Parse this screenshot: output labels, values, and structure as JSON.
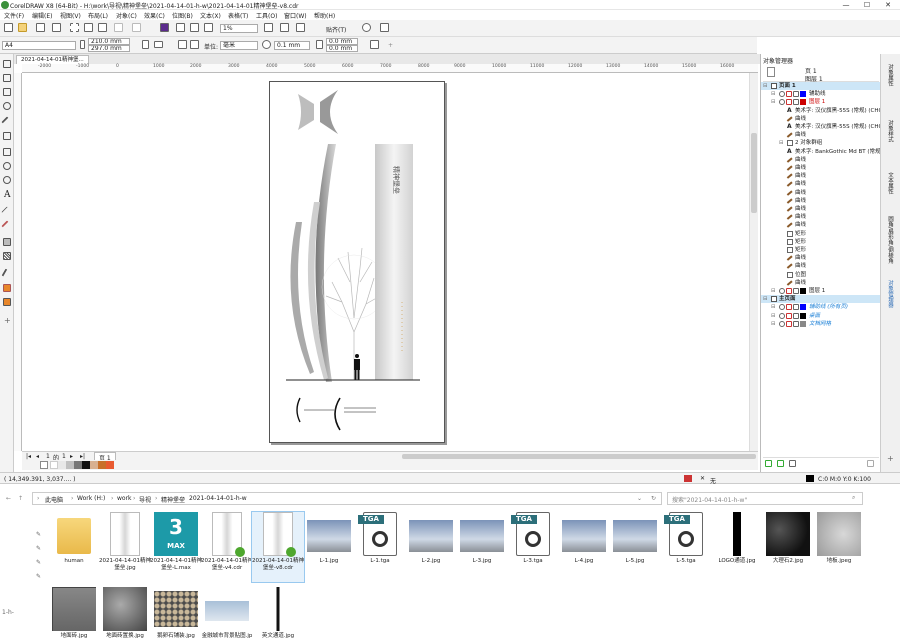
{
  "window": {
    "title": "CorelDRAW X8 (64-Bit) - H:\\work\\导视\\精神堡垒\\2021-04-14-01-h-w\\2021-04-14-01精神堡垒-v8.cdr",
    "minimize": "—",
    "maximize": "☐",
    "close": "✕"
  },
  "menu": [
    "文件(F)",
    "编辑(E)",
    "视图(V)",
    "布局(L)",
    "对象(C)",
    "效果(C)",
    "位图(B)",
    "文本(X)",
    "表格(T)",
    "工具(O)",
    "窗口(W)",
    "帮助(H)"
  ],
  "toolbar": {
    "zoom": "1%",
    "snap_label": "贴齐(T)"
  },
  "propbar": {
    "page_size": "A4",
    "width": "210.0 mm",
    "height": "297.0 mm",
    "units_label": "单位:",
    "units": "毫米",
    "nudge": "0.1 mm",
    "dup_offset": "20.0 mm",
    "dup_x": "0.0 mm",
    "dup_y": "0.0 mm"
  },
  "document_tab": "2021-04-14-01精神堡...",
  "ruler_ticks": [
    "-2000",
    "-1000",
    "0",
    "1000",
    "2000",
    "3000",
    "4000",
    "5000",
    "6000",
    "7000",
    "8000",
    "9000",
    "10000",
    "11000",
    "12000",
    "13000",
    "14000",
    "15000",
    "16000",
    "17000"
  ],
  "artwork": {
    "column_text": "精神堡垒"
  },
  "page_nav": {
    "current": "1",
    "of": "的",
    "total": "1",
    "page_tab": "页 1"
  },
  "status": {
    "coords": "( 14,349.391, 3,037.... )",
    "fill_none": "无",
    "color_info": "C:0 M:0 Y:0 K:100"
  },
  "docker": {
    "title": "对象管理器",
    "header_page": "页 1",
    "header_layer": "图层 1",
    "rows": [
      {
        "indent": 0,
        "label": "页面 1",
        "kind": "page",
        "icon": "page-icon",
        "selected": true
      },
      {
        "indent": 1,
        "label": "辅助线",
        "kind": "layer",
        "icon": "layer-icon",
        "color": "#0000ff"
      },
      {
        "indent": 1,
        "label": "图层 1",
        "kind": "layer-red",
        "icon": "layer-icon",
        "color": "#cc0000"
      },
      {
        "indent": 2,
        "label": "美术字: 汉仪旗黑-55S (常规) (CHC)",
        "icon": "text-icon"
      },
      {
        "indent": 2,
        "label": "曲线",
        "icon": "curve-icon"
      },
      {
        "indent": 2,
        "label": "美术字: 汉仪旗黑-55S (常规) (CHC)",
        "icon": "text-icon"
      },
      {
        "indent": 2,
        "label": "曲线",
        "icon": "curve-icon"
      },
      {
        "indent": 2,
        "label": "2 对象群组",
        "icon": "group-icon"
      },
      {
        "indent": 2,
        "label": "美术字: BankGothic Md BT (常规)",
        "icon": "text-icon"
      },
      {
        "indent": 2,
        "label": "曲线",
        "icon": "curve-icon"
      },
      {
        "indent": 2,
        "label": "曲线",
        "icon": "curve-icon"
      },
      {
        "indent": 2,
        "label": "曲线",
        "icon": "curve-icon"
      },
      {
        "indent": 2,
        "label": "曲线",
        "icon": "curve-icon"
      },
      {
        "indent": 2,
        "label": "曲线",
        "icon": "curve-icon"
      },
      {
        "indent": 2,
        "label": "曲线",
        "icon": "curve-icon"
      },
      {
        "indent": 2,
        "label": "曲线",
        "icon": "curve-icon"
      },
      {
        "indent": 2,
        "label": "曲线",
        "icon": "curve-icon"
      },
      {
        "indent": 2,
        "label": "曲线",
        "icon": "curve-icon"
      },
      {
        "indent": 2,
        "label": "矩形",
        "icon": "rect-icon"
      },
      {
        "indent": 2,
        "label": "矩形",
        "icon": "rect-icon"
      },
      {
        "indent": 2,
        "label": "矩形",
        "icon": "rect-icon"
      },
      {
        "indent": 2,
        "label": "曲线",
        "icon": "curve-icon"
      },
      {
        "indent": 2,
        "label": "曲线",
        "icon": "curve-icon"
      },
      {
        "indent": 2,
        "label": "位图",
        "icon": "bitmap-icon"
      },
      {
        "indent": 2,
        "label": "曲线",
        "icon": "curve-icon"
      },
      {
        "indent": 1,
        "label": "图层 1",
        "kind": "layer",
        "icon": "layer-icon",
        "color": "#000000"
      },
      {
        "indent": 0,
        "label": "主页面",
        "kind": "page",
        "icon": "page-icon",
        "selected": true
      },
      {
        "indent": 1,
        "label": "辅助线 (所有页)",
        "kind": "master",
        "icon": "layer-icon",
        "color": "#0000ff"
      },
      {
        "indent": 1,
        "label": "桌面",
        "kind": "master",
        "icon": "layer-icon",
        "color": "#000000"
      },
      {
        "indent": 1,
        "label": "文档网格",
        "kind": "master",
        "icon": "layer-icon",
        "color": "#888888"
      }
    ],
    "side_tabs": [
      "对象属性",
      "对象样式",
      "文本属性",
      "圆角/扇形角/倒棱角",
      "对象管理器"
    ]
  },
  "explorer": {
    "breadcrumb": [
      "此电脑",
      "Work (H:)",
      "work",
      "导视",
      "精神堡垒",
      "2021-04-14-01-h-w"
    ],
    "search_placeholder": "搜索\"2021-04-14-01-h-w\"",
    "side_label": "1-h-",
    "files": [
      {
        "name": "human",
        "type": "folder"
      },
      {
        "name": "2021-04-14-01精神堡垒.jpg",
        "type": "doc"
      },
      {
        "name": "2021-04-14-01精神堡垒-L.max",
        "type": "max"
      },
      {
        "name": "2021-04-14-01精神堡垒-v4.cdr",
        "type": "cdr"
      },
      {
        "name": "2021-04-14-01精神堡垒-v8.cdr",
        "type": "cdr",
        "selected": true
      },
      {
        "name": "L-1.jpg",
        "type": "render"
      },
      {
        "name": "L-1.tga",
        "type": "tga"
      },
      {
        "name": "L-2.jpg",
        "type": "render"
      },
      {
        "name": "L-3.jpg",
        "type": "render"
      },
      {
        "name": "L-3.tga",
        "type": "tga"
      },
      {
        "name": "L-4.jpg",
        "type": "render"
      },
      {
        "name": "L-5.jpg",
        "type": "render"
      },
      {
        "name": "L-5.tga",
        "type": "tga"
      },
      {
        "name": "LOGO通道.jpg",
        "type": "logo"
      },
      {
        "name": "大理石2.jpg",
        "type": "marble-dark"
      },
      {
        "name": "地板.jpeg",
        "type": "stone-light"
      },
      {
        "name": "地面砖.jpg",
        "type": "tile"
      },
      {
        "name": "地面砖置换.jpg",
        "type": "tile-dark"
      },
      {
        "name": "鹅卵石铺装.jpg",
        "type": "pebble"
      },
      {
        "name": "金融城市背景贴图.jpeg",
        "type": "city"
      },
      {
        "name": "英文通道.jpg",
        "type": "strip"
      }
    ],
    "tga_badge": "TGA",
    "max_badge": "3",
    "max_label": "MAX"
  },
  "colors": {
    "accent": "#2f6db5",
    "selected_row": "#cde6f7",
    "red_layer": "#cc0000",
    "master_text": "#1a7fd6"
  }
}
